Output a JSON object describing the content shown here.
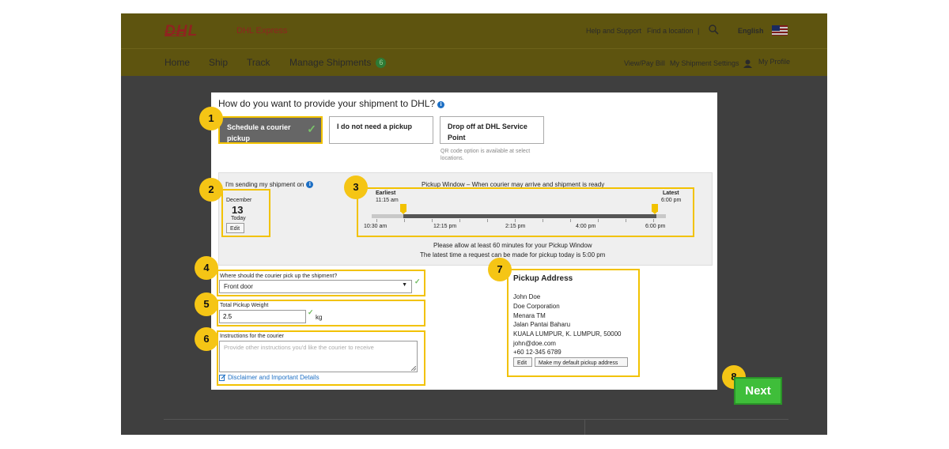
{
  "header": {
    "logo_text": "DHL",
    "brand": "DHL Express",
    "links": [
      "Help and Support",
      "Find a location",
      "|"
    ],
    "language": "English",
    "icons": {
      "search": "search-icon",
      "flag": "malaysia-flag-icon",
      "user": "user-icon"
    }
  },
  "nav": {
    "items": [
      "Home",
      "Ship",
      "Track",
      "Manage Shipments"
    ],
    "manage_badge": "6",
    "right": [
      "View/Pay Bill",
      "My Shipment Settings",
      "My Profile"
    ]
  },
  "modal": {
    "question": "How do you want to provide your shipment to DHL?",
    "options": [
      {
        "label": "Schedule a courier pickup",
        "selected": true
      },
      {
        "label": "I do not need a pickup",
        "selected": false
      },
      {
        "label": "Drop off at DHL Service Point",
        "selected": false
      }
    ],
    "qr_note": "QR code option is available at select locations."
  },
  "date": {
    "label": "I'm sending my shipment on",
    "month": "December",
    "day": "13",
    "today": "Today",
    "edit": "Edit"
  },
  "window": {
    "title": "Pickup Window – When courier may arrive and shipment is ready",
    "earliest_label": "Earliest",
    "earliest_time": "11:15 am",
    "latest_label": "Latest",
    "latest_time": "6:00 pm",
    "ticks": [
      "10:30 am",
      "12:15 pm",
      "2:15 pm",
      "4:00 pm",
      "6:00 pm"
    ],
    "note1": "Please allow at least 60 minutes for your Pickup Window",
    "note2": "The latest time a request can be made for pickup today is 5:00 pm"
  },
  "location": {
    "label": "Where should the courier pick up the shipment?",
    "value": "Front door"
  },
  "weight": {
    "label": "Total Pickup Weight",
    "value": "2.5",
    "unit": "kg"
  },
  "instructions": {
    "label": "Instructions for the courier",
    "placeholder": "Provide other instructions you'd like the courier to receive",
    "disclaimer": "Disclaimer and Important Details"
  },
  "address": {
    "title": "Pickup Address",
    "lines": [
      "John Doe",
      "Doe Corporation",
      "Menara TM",
      "Jalan Pantai Baharu",
      "KUALA LUMPUR, K. LUMPUR, 50000",
      "john@doe.com",
      "+60 12-345 6789"
    ],
    "edit": "Edit",
    "default": "Make my default pickup address"
  },
  "steps": [
    "1",
    "2",
    "3",
    "4",
    "5",
    "6",
    "7",
    "8"
  ],
  "next": "Next",
  "colors": {
    "highlight": "#f2c200",
    "next": "#3fbe3a",
    "header": "#5e540f"
  }
}
